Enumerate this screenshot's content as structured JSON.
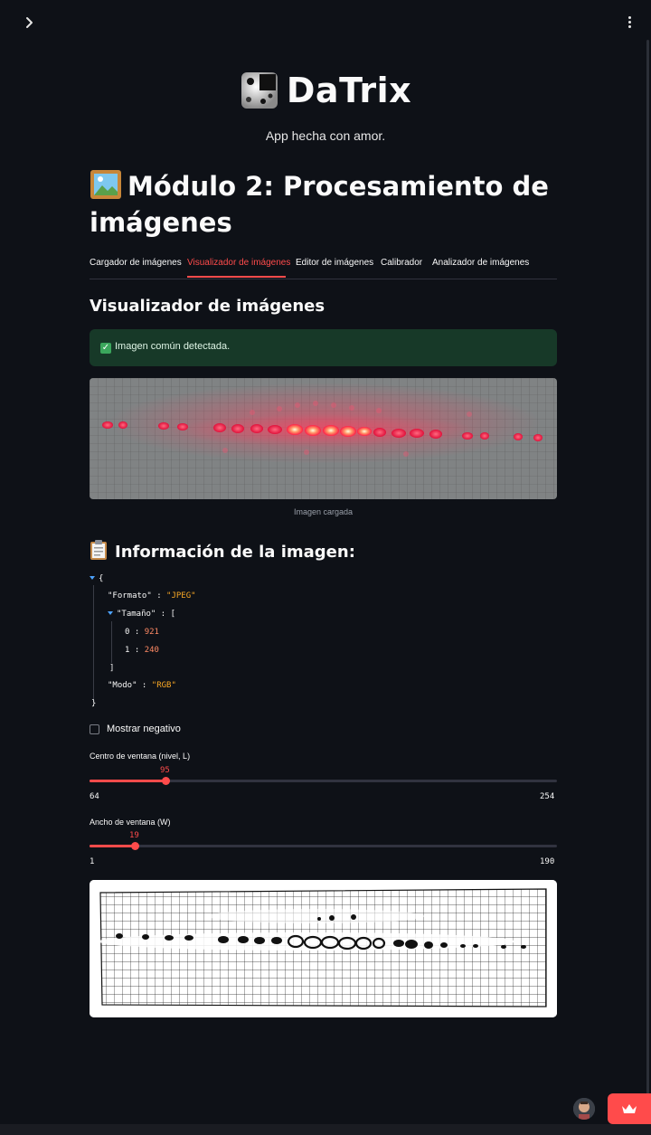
{
  "app": {
    "title": "DaTrix",
    "subtitle": "App hecha con amor."
  },
  "module": {
    "title": "Módulo 2: Procesamiento de imágenes"
  },
  "tabs": [
    {
      "label": "Cargador de imágenes",
      "active": false
    },
    {
      "label": "Visualizador de imágenes",
      "active": true
    },
    {
      "label": "Editor de imágenes",
      "active": false
    },
    {
      "label": "Calibrador",
      "active": false
    },
    {
      "label": "Analizador de imágenes",
      "active": false
    }
  ],
  "section_title": "Visualizador de imágenes",
  "alert": {
    "text": "Imagen común detectada.",
    "color": "#173928"
  },
  "image": {
    "caption": "Imagen cargada"
  },
  "info": {
    "title": "Información de la imagen:",
    "json": {
      "format_key": "\"Formato\"",
      "format_value": "\"JPEG\"",
      "size_key": "\"Tamaño\"",
      "size_idx0": "0",
      "size_val0": "921",
      "size_idx1": "1",
      "size_val1": "240",
      "mode_key": "\"Modo\"",
      "mode_value": "\"RGB\""
    }
  },
  "negative_checkbox": {
    "label": "Mostrar negativo",
    "checked": false
  },
  "sliders": {
    "center": {
      "label": "Centro de ventana (nivel, L)",
      "value": "95",
      "min": "64",
      "max": "254"
    },
    "width": {
      "label": "Ancho de ventana (W)",
      "value": "19",
      "min": "1",
      "max": "190"
    }
  },
  "colors": {
    "accent": "#ff4b4b",
    "background": "#0e1117",
    "success_bg": "#173928"
  },
  "icons": {
    "sidebar_toggle": "chevron-right-icon",
    "menu": "kebab-menu-icon",
    "deploy": "crown-icon"
  }
}
